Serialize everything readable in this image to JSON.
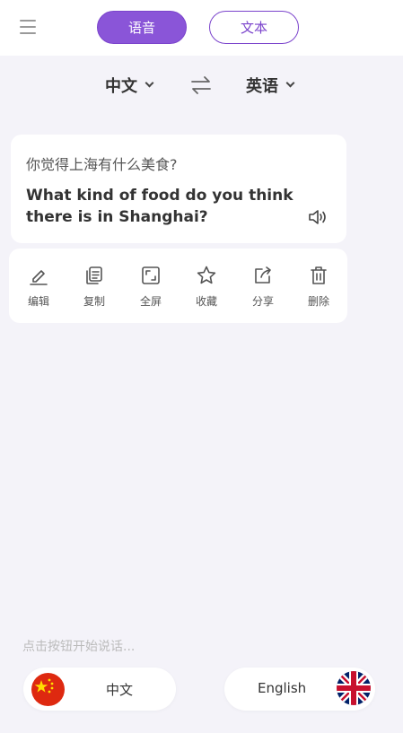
{
  "header": {
    "voice_label": "语音",
    "text_label": "文本",
    "accent": "#8a55d8"
  },
  "languages": {
    "source": "中文",
    "target": "英语"
  },
  "translation": {
    "source_text": "你觉得上海有什么美食?",
    "target_line1": "What kind of food do you think",
    "target_line2": "there is in Shanghai?"
  },
  "actions": [
    {
      "label": "编辑",
      "icon": "edit-icon"
    },
    {
      "label": "复制",
      "icon": "copy-icon"
    },
    {
      "label": "全屏",
      "icon": "fullscreen-icon"
    },
    {
      "label": "收藏",
      "icon": "star-icon"
    },
    {
      "label": "分享",
      "icon": "share-icon"
    },
    {
      "label": "删除",
      "icon": "trash-icon"
    }
  ],
  "bottom": {
    "hint": "点击按钮开始说话...",
    "zh_label": "中文",
    "en_label": "English"
  }
}
